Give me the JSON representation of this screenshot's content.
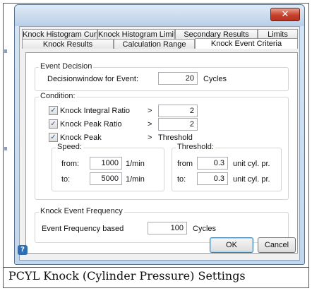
{
  "dialog": {
    "close_glyph": "✕",
    "tabs_row1": [
      "Knock Histogram Curves",
      "Knock Histogram Limits",
      "Secondary Results",
      "Limits"
    ],
    "tabs_row2": [
      "Knock Results",
      "Calculation Range",
      "Knock Event Criteria"
    ],
    "active_tab": "Knock Event Criteria",
    "event_decision": {
      "title": "Event Decision",
      "label": "Decisionwindow for Event:",
      "value": "20",
      "unit": "Cycles"
    },
    "condition": {
      "title": "Condition:",
      "rows": [
        {
          "label": "Knock Integral Ratio",
          "checked": true,
          "op": ">",
          "value": "2"
        },
        {
          "label": "Knock Peak Ratio",
          "checked": true,
          "op": ">",
          "value": "2"
        },
        {
          "label": "Knock Peak",
          "checked": true,
          "op": ">",
          "text": "Threshold"
        }
      ],
      "speed": {
        "title": "Speed:",
        "from_label": "from:",
        "from_value": "1000",
        "to_label": "to:",
        "to_value": "5000",
        "unit": "1/min"
      },
      "threshold": {
        "title": "Threshold:",
        "from_label": "from",
        "from_value": "0.3",
        "to_label": "to:",
        "to_value": "0.3",
        "unit": "unit cyl. pr."
      }
    },
    "frequency": {
      "title": "Knock Event Frequency",
      "label": "Event Frequency based",
      "value": "100",
      "unit": "Cycles"
    },
    "buttons": {
      "ok": "OK",
      "cancel": "Cancel"
    }
  },
  "caption": "PCYL Knock (Cylinder Pressure) Settings"
}
